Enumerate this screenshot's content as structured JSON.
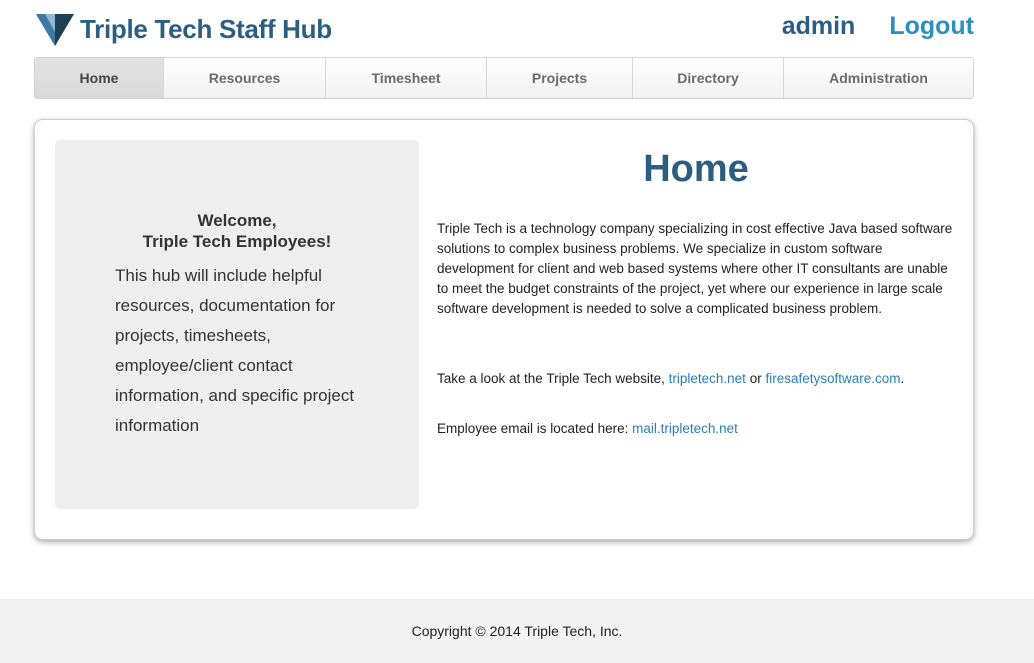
{
  "header": {
    "logo_icon": "triangle-logo-icon",
    "title": "Triple Tech Staff Hub",
    "user": "admin",
    "logout": "Logout",
    "colors": {
      "title": "#2b5e80",
      "logout": "#2d8ec0"
    }
  },
  "nav": {
    "items": [
      {
        "label": "Home",
        "active": true
      },
      {
        "label": "Resources",
        "active": false
      },
      {
        "label": "Timesheet",
        "active": false
      },
      {
        "label": "Projects",
        "active": false
      },
      {
        "label": "Directory",
        "active": false
      },
      {
        "label": "Administration",
        "active": false
      }
    ]
  },
  "welcome": {
    "title_line1": "Welcome,",
    "title_line2": "Triple Tech Employees!",
    "body": "This hub will include helpful resources, documentation for projects, timesheets, employee/client contact information, and specific project information"
  },
  "main": {
    "heading": "Home",
    "paragraph1": "Triple Tech is a technology company specializing in cost effective Java based software solutions to complex business problems. We specialize in custom software development for client and web based systems where other IT consultants are unable to meet the budget constraints of the project, yet where our experience in large scale software development is needed to solve a complicated business problem.",
    "paragraph2_prefix": "Take a look at the Triple Tech website, ",
    "link_tripletech": "tripletech.net",
    "paragraph2_or": " or ",
    "link_firesafety": "firesafetysoftware.com",
    "paragraph2_suffix": ".",
    "paragraph3_prefix": "Employee email is located here: ",
    "link_mail": "mail.tripletech.net"
  },
  "footer": {
    "copyright": "Copyright © 2014 Triple Tech, Inc."
  }
}
